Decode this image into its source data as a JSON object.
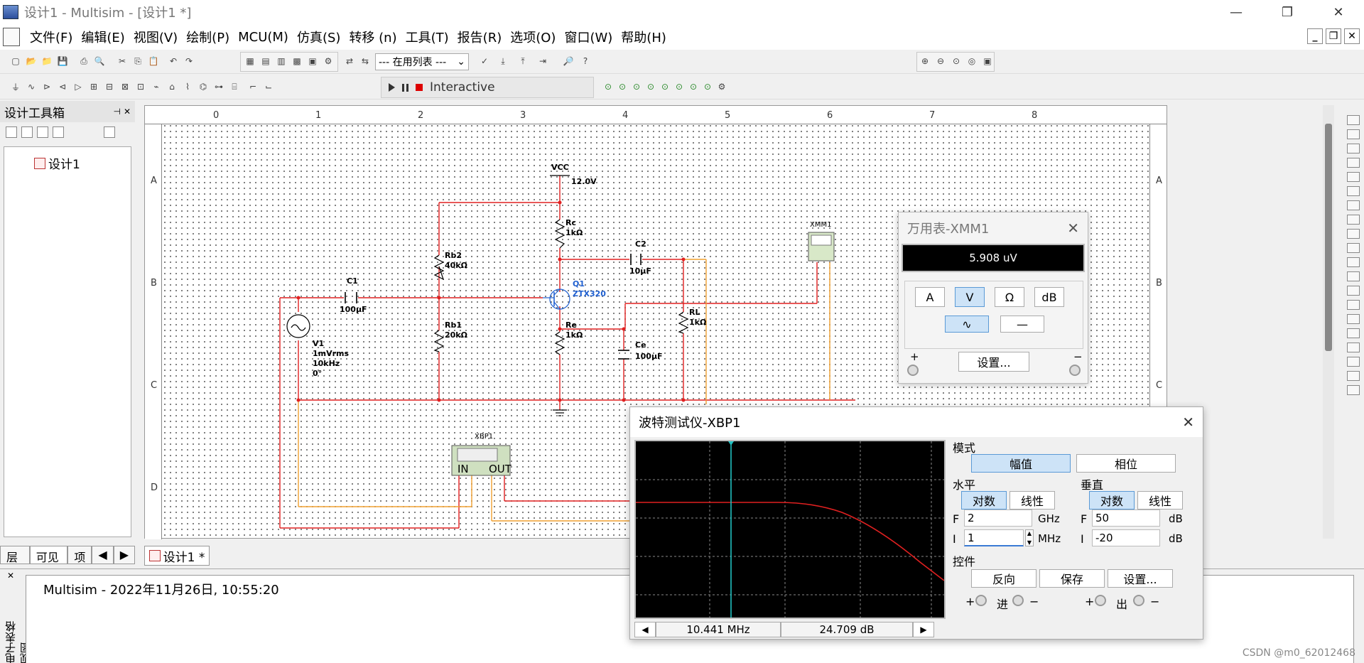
{
  "window": {
    "title": "设计1 - Multisim - [设计1 *]",
    "minimize": "—",
    "maximize": "❐",
    "close": "✕"
  },
  "menu": [
    "文件(F)",
    "编辑(E)",
    "视图(V)",
    "绘制(P)",
    "MCU(M)",
    "仿真(S)",
    "转移 (n)",
    "工具(T)",
    "报告(R)",
    "选项(O)",
    "窗口(W)",
    "帮助(H)"
  ],
  "mdi_controls": [
    "_",
    "❐",
    "✕"
  ],
  "toolbar": {
    "inuse_list": "--- 在用列表 ---",
    "interactive": "Interactive"
  },
  "left_panel": {
    "title": "设计工具箱",
    "tree_item": "设计1",
    "tabs": [
      "层级",
      "可见度",
      "项"
    ]
  },
  "document_tab": "设计1 *",
  "rulers": {
    "top": [
      "0",
      "1",
      "2",
      "3",
      "4",
      "5",
      "6",
      "7",
      "8"
    ],
    "left": [
      "A",
      "B",
      "C",
      "D"
    ]
  },
  "schematic": {
    "vcc_label": "VCC",
    "vcc_value": "12.0V",
    "rc_name": "Rc",
    "rc_value": "1kΩ",
    "rb2_name": "Rb2",
    "rb2_value": "40kΩ",
    "rb1_name": "Rb1",
    "rb1_value": "20kΩ",
    "re_name": "Re",
    "re_value": "1kΩ",
    "rl_name": "RL",
    "rl_value": "1kΩ",
    "c1_name": "C1",
    "c1_value": "100µF",
    "c2_name": "C2",
    "c2_value": "10µF",
    "ce_name": "Ce",
    "ce_value": "100µF",
    "q1_name": "Q1",
    "q1_model": "ZTX320",
    "v1_name": "V1",
    "v1_amp": "1mVrms",
    "v1_freq": "10kHz",
    "v1_phase": "0°",
    "xmm1_label": "XMM1",
    "xbp1_label": "XBP1",
    "xbp1_in": "IN",
    "xbp1_out": "OUT",
    "wire_color_red": "#e02020",
    "wire_color_orange": "#f0a030"
  },
  "multimeter": {
    "title": "万用表-XMM1",
    "reading": "5.908 uV",
    "buttons": [
      "A",
      "V",
      "Ω",
      "dB"
    ],
    "selected": "V",
    "settings": "设置...",
    "plus": "+",
    "minus": "−"
  },
  "bode": {
    "title": "波特测试仪-XBP1",
    "mode_label": "模式",
    "mode_mag": "幅值",
    "mode_phase": "相位",
    "horizontal_label": "水平",
    "vertical_label": "垂直",
    "log": "对数",
    "linear": "线性",
    "h_f_label": "F",
    "h_f_value": "2",
    "h_f_unit": "GHz",
    "h_i_label": "I",
    "h_i_value": "1",
    "h_i_unit": "MHz",
    "v_f_label": "F",
    "v_f_value": "50",
    "v_f_unit": "dB",
    "v_i_label": "I",
    "v_i_value": "-20",
    "v_i_unit": "dB",
    "controls_label": "控件",
    "reverse": "反向",
    "save": "保存",
    "settings": "设置...",
    "cursor_freq": "10.441 MHz",
    "cursor_gain": "24.709 dB",
    "in_label": "进",
    "out_label": "出",
    "plus": "+",
    "minus": "−"
  },
  "output": {
    "side_label": "电子表格视图",
    "log_line": "Multisim  -  2022年11月26日, 10:55:20"
  },
  "watermark": "CSDN @m0_62012468"
}
